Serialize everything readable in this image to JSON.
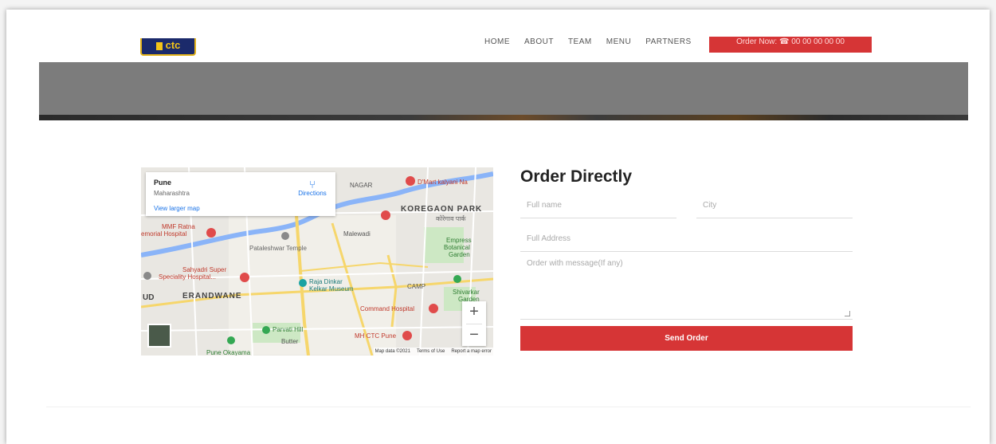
{
  "header": {
    "logo_text": "ctc",
    "nav": [
      "HOME",
      "ABOUT",
      "TEAM",
      "MENU",
      "PARTNERS"
    ],
    "order_now": "Order Now: ☎ 00 00 00 00 00"
  },
  "map": {
    "card": {
      "city": "Pune",
      "state": "Maharashtra",
      "view_larger": "View larger map",
      "directions": "Directions"
    },
    "labels": {
      "nagar": "NAGAR",
      "dmart": "D'Mart kalyani Na",
      "koregaon": "KOREGAON PARK",
      "koregaon_local": "कोरेगाव पार्क",
      "mmf": "MMF Ratna",
      "memorial": "emorial Hospital",
      "malewadi": "Malewadi",
      "pataleshwar": "Pataleshwar Temple",
      "empress": "Empress",
      "botanical": "Botanical",
      "garden": "Garden",
      "sahyadri": "Sahyadri Super",
      "speciality": "Speciality Hospital...",
      "raja": "Raja Dinkar",
      "kelkar": "Kelkar Museum",
      "camp": "CAMP",
      "shivarkar": "Shivarkar",
      "shivarkar_garden": "Garden",
      "ud": "UD",
      "erandwane": "ERANDWANE",
      "command": "Command Hospital",
      "parvati": "Parvati Hill",
      "mh_ctc": "MH CTC Pune",
      "butter": "Butter",
      "pune_okayama": "Pune Okayama"
    },
    "zoom_in": "+",
    "zoom_out": "−",
    "attribution": [
      "Map data ©2021",
      "Terms of Use",
      "Report a map error"
    ]
  },
  "form": {
    "title": "Order Directly",
    "full_name_placeholder": "Full name",
    "city_placeholder": "City",
    "address_placeholder": "Full Address",
    "message_placeholder": "Order with message(If any)",
    "send": "Send Order"
  },
  "colors": {
    "accent": "#d63536",
    "hero": "#7c7c7c",
    "logo_bg": "#1b2a6b",
    "logo_fg": "#f5c518"
  }
}
